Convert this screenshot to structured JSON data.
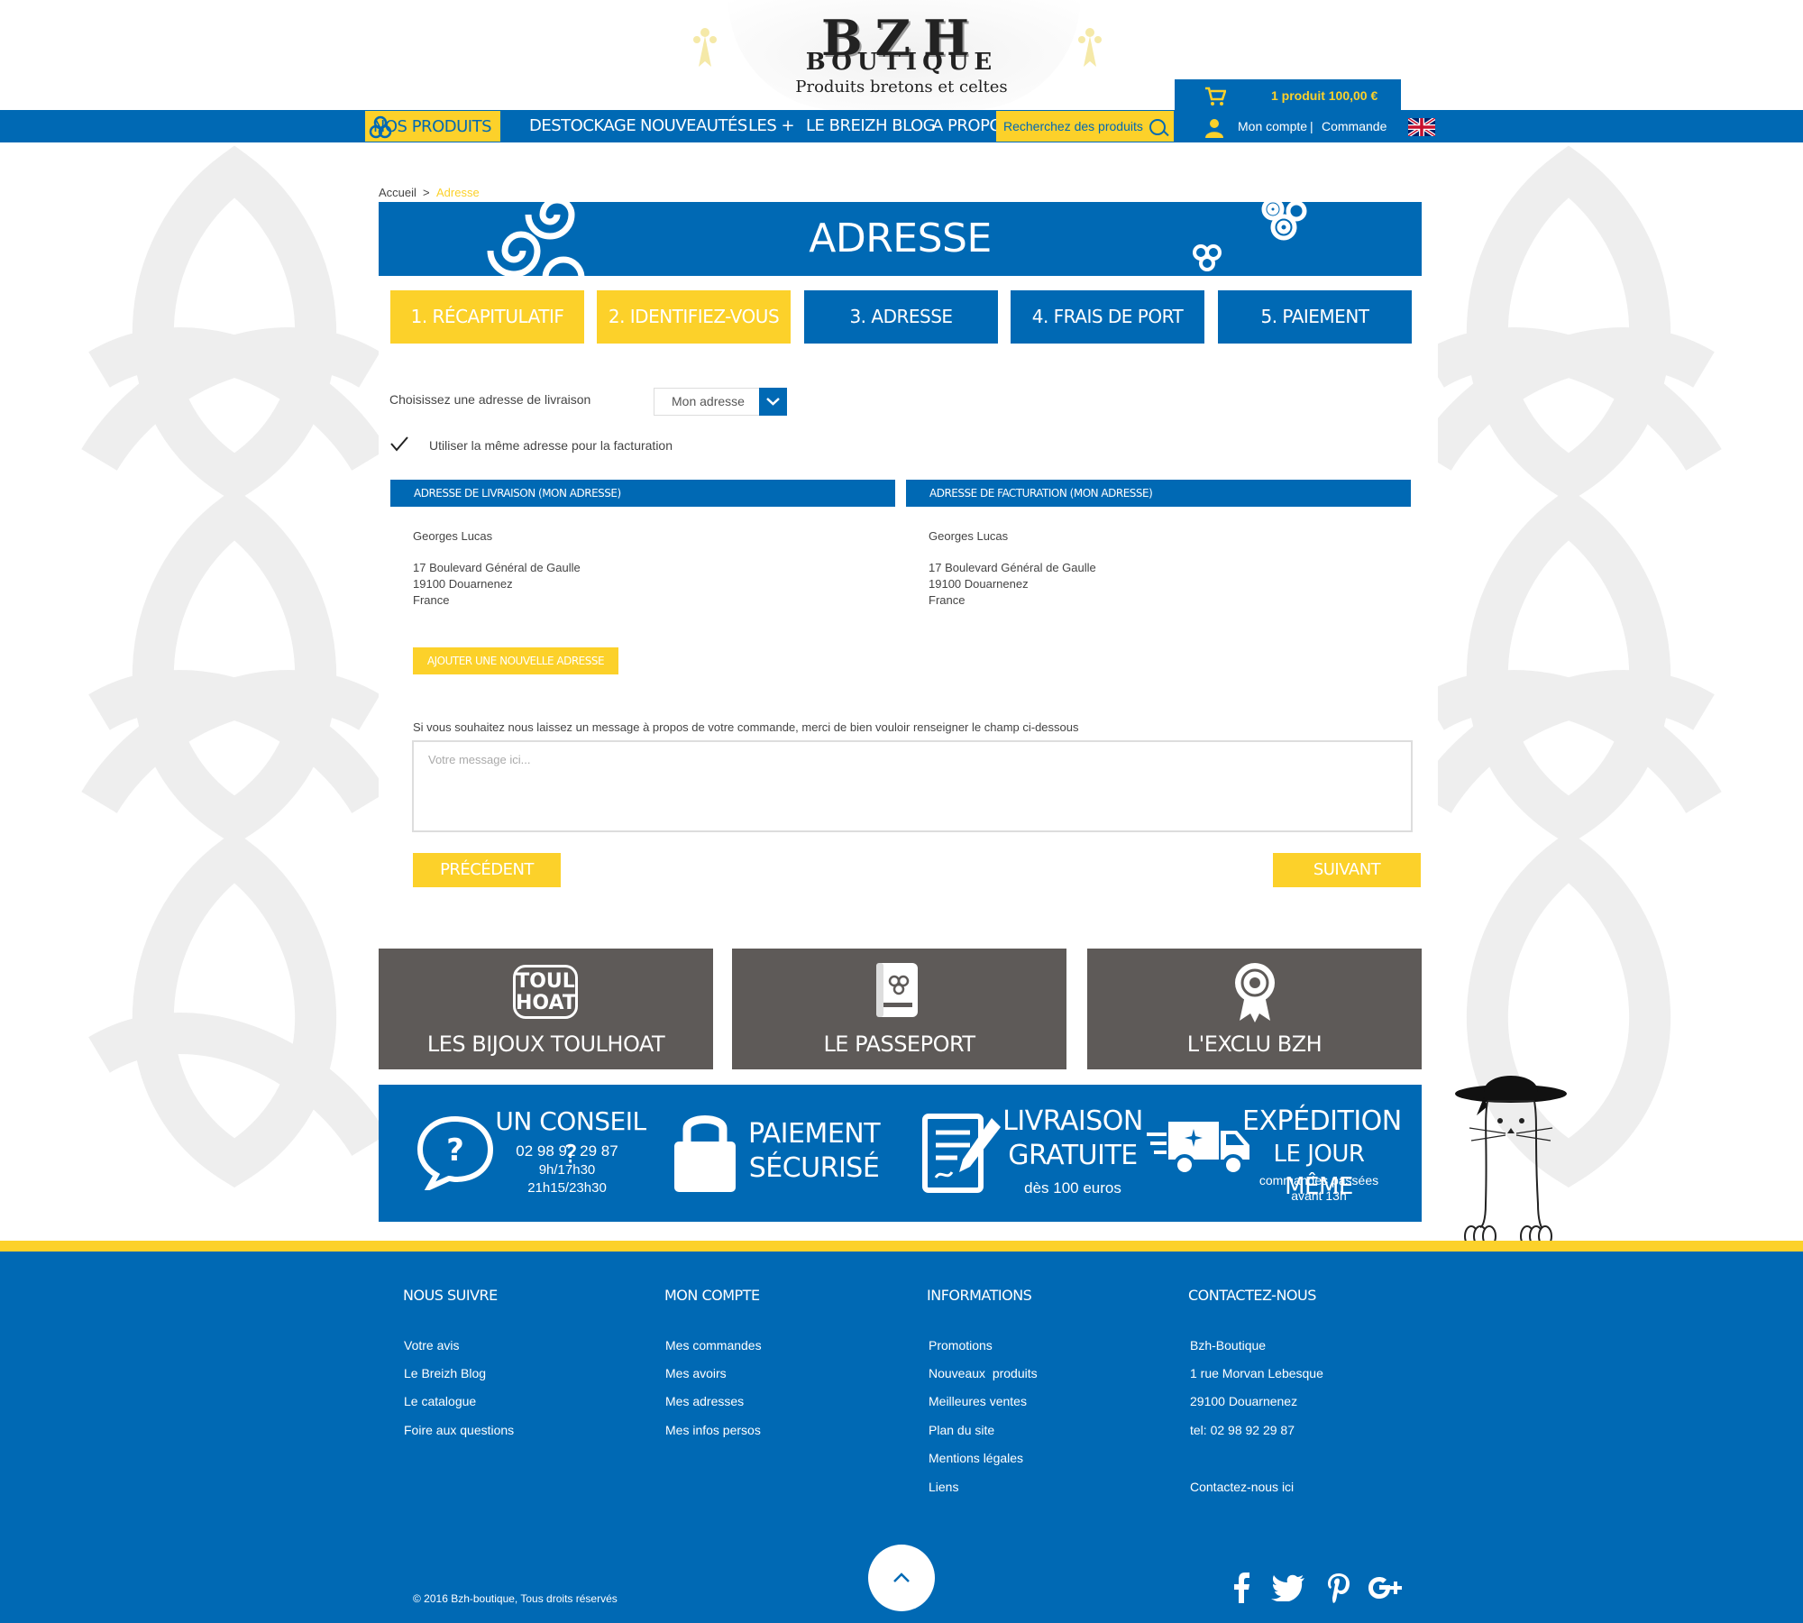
{
  "header": {
    "logo_title": "BZH",
    "logo_subtitle": "BOUTIQUE",
    "tagline": "Produits bretons et celtes",
    "cart_summary": "1 produit 100,00 €",
    "account_link": "Mon compte",
    "account_sep": "|",
    "order_link": "Commande"
  },
  "nav": {
    "items": [
      "NOS PRODUITS",
      "DESTOCKAGE",
      "NOUVEAUTÉS",
      "LES +",
      "LE BREIZH BLOG",
      "A PROPOS"
    ],
    "search_placeholder": "Recherchez des produits"
  },
  "breadcrumb": {
    "home": "Accueil",
    "separator": ">",
    "current": "Adresse"
  },
  "page_title": "ADRESSE",
  "steps": [
    {
      "label": "1. RÉCAPITULATIF",
      "state": "done"
    },
    {
      "label": "2. IDENTIFIEZ-VOUS",
      "state": "done"
    },
    {
      "label": "3. ADRESSE",
      "state": "pending"
    },
    {
      "label": "4. FRAIS DE PORT",
      "state": "pending"
    },
    {
      "label": "5. PAIEMENT",
      "state": "pending"
    }
  ],
  "form": {
    "choose_label": "Choisissez une adresse de livraison",
    "address_select_value": "Mon adresse",
    "same_billing_label": "Utiliser la même adresse pour la facturation",
    "same_billing_checked": true
  },
  "delivery_address": {
    "heading": "ADRESSE DE LIVRAISON (MON ADRESSE)",
    "name": "Georges Lucas",
    "street": "17 Boulevard Général de Gaulle",
    "city": "19100 Douarnenez",
    "country": "France"
  },
  "billing_address": {
    "heading": "ADRESSE DE FACTURATION (MON ADRESSE)",
    "name": "Georges Lucas",
    "street": "17 Boulevard Général de Gaulle",
    "city": "19100 Douarnenez",
    "country": "France"
  },
  "add_address_label": "AJOUTER UNE NOUVELLE ADRESSE",
  "message": {
    "prompt": "Si vous souhaitez nous laissez un message à propos de votre commande, merci de bien vouloir renseigner le champ ci-dessous",
    "placeholder": "Votre message ici..."
  },
  "buttons": {
    "previous": "PRÉCÉDENT",
    "next": "SUIVANT"
  },
  "promo_tiles": [
    {
      "label": "LES BIJOUX TOULHOAT",
      "icon_text": "TOUL HOAT",
      "icon": "toulhoat-logo-icon"
    },
    {
      "label": "LE PASSEPORT",
      "icon": "passport-icon"
    },
    {
      "label": "L'EXCLU BZH",
      "icon": "award-ribbon-icon"
    }
  ],
  "reassurance": {
    "advice_title": "UN CONSEIL ?",
    "advice_phone": "02 98 92 29 87",
    "advice_hours1": "9h/17h30",
    "advice_hours2": "21h15/23h30",
    "payment_line1": "PAIEMENT",
    "payment_line2": "SÉCURISÉ",
    "delivery_line1": "LIVRAISON",
    "delivery_line2": "GRATUITE",
    "delivery_note": "dès 100 euros",
    "shipping_line1": "EXPÉDITION",
    "shipping_line2": "LE JOUR MÊME",
    "shipping_note1": "commandes passées",
    "shipping_note2": "avant 13h"
  },
  "footer": {
    "columns": [
      {
        "title": "NOUS SUIVRE",
        "links": [
          "Votre avis",
          "Le Breizh Blog",
          "Le catalogue",
          "Foire aux questions"
        ]
      },
      {
        "title": "MON COMPTE",
        "links": [
          "Mes commandes",
          "Mes avoirs",
          "Mes adresses",
          "Mes infos persos"
        ]
      },
      {
        "title": "INFORMATIONS",
        "links": [
          "Promotions",
          "Nouveaux  produits",
          "Meilleures ventes",
          "Plan du site",
          "Mentions légales",
          "Liens"
        ]
      },
      {
        "title": "CONTACTEZ-NOUS",
        "links": [
          "Bzh-Boutique",
          "1 rue Morvan Lebesque",
          "29100 Douarnenez",
          "tel: 02 98 92 29 87",
          "Contactez-nous ici"
        ]
      }
    ],
    "copyright": "© 2016  Bzh-boutique, Tous droits réservés",
    "social": [
      {
        "icon": "facebook-icon",
        "glyph": "f"
      },
      {
        "icon": "twitter-icon",
        "glyph": "t"
      },
      {
        "icon": "pinterest-icon",
        "glyph": "p"
      },
      {
        "icon": "google-plus-icon",
        "glyph": "g+"
      }
    ]
  },
  "colors": {
    "primary_blue": "#0069b4",
    "accent_yellow": "#fcd12a",
    "tile_gray": "#5e5a58"
  }
}
